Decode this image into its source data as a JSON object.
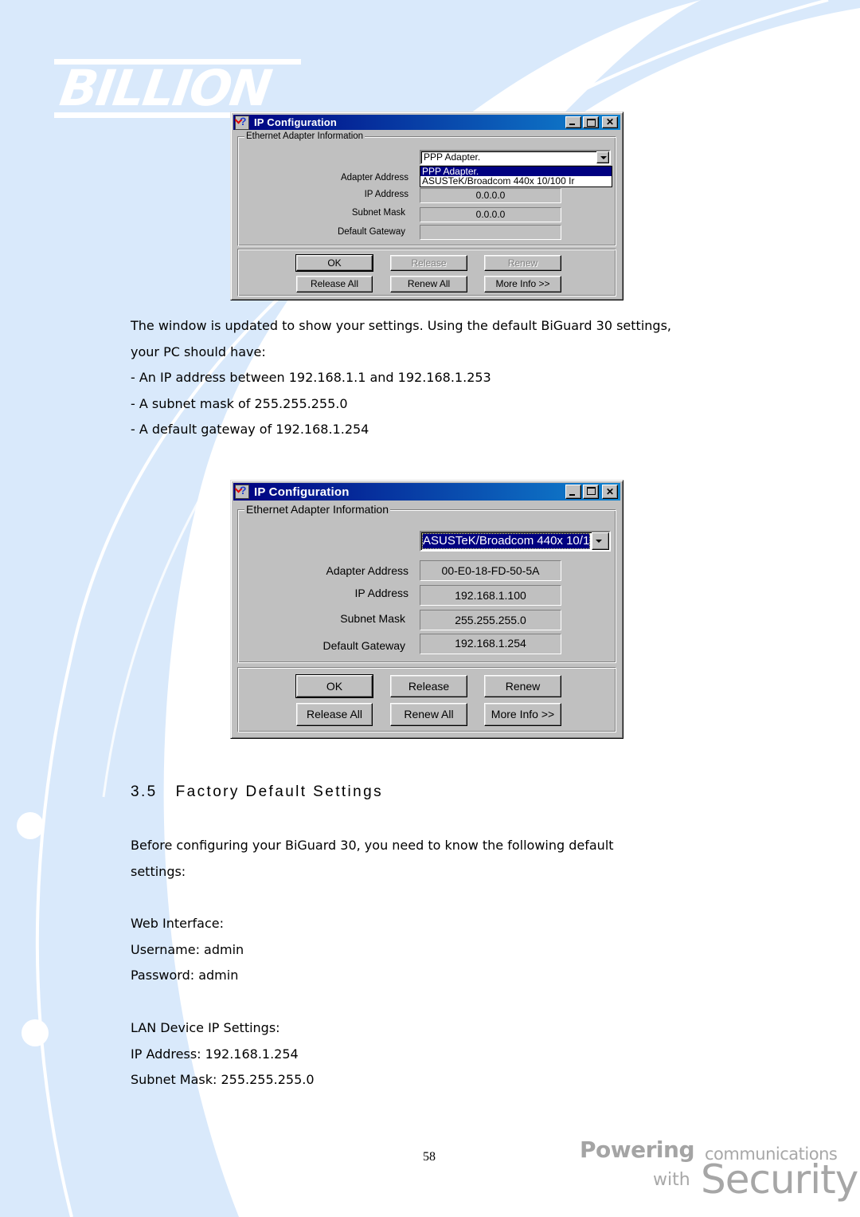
{
  "brand": {
    "logo_text": "BILLION",
    "tagline_powering": "Powering",
    "tagline_communications": "communications",
    "tagline_with": "with",
    "tagline_security": "Security",
    "colors": {
      "background_sweep": "#d9e9fb",
      "titlebar_start": "#000080",
      "titlebar_end": "#1084d0",
      "dialog_face": "#c0c0c0"
    }
  },
  "dialog1": {
    "title": "IP Configuration",
    "title_icon": "help-question-icon",
    "group_label": "Ethernet  Adapter Information",
    "adapter_select_value": "PPP Adapter.",
    "dropdown_open": true,
    "dropdown_options": [
      {
        "label": "PPP Adapter.",
        "highlighted": true
      },
      {
        "label": "ASUSTeK/Broadcom 440x 10/100 Ir",
        "highlighted": false
      }
    ],
    "rows": [
      {
        "label": "Adapter Address",
        "value": ""
      },
      {
        "label": "IP Address",
        "value": "0.0.0.0"
      },
      {
        "label": "Subnet Mask",
        "value": "0.0.0.0"
      },
      {
        "label": "Default Gateway",
        "value": ""
      }
    ],
    "buttons": [
      {
        "label": "OK",
        "enabled": true,
        "default": true
      },
      {
        "label": "Release",
        "enabled": false
      },
      {
        "label": "Renew",
        "enabled": false
      },
      {
        "label": "Release All",
        "enabled": true
      },
      {
        "label": "Renew All",
        "enabled": true
      },
      {
        "label": "More Info >>",
        "enabled": true
      }
    ]
  },
  "paragraph1": {
    "lines": [
      "The window is updated to show your settings. Using the default BiGuard 30 settings,",
      "your PC should have:",
      "- An IP address between 192.168.1.1 and 192.168.1.253",
      "- A subnet mask of 255.255.255.0",
      "- A default gateway of 192.168.1.254"
    ]
  },
  "dialog2": {
    "title": "IP Configuration",
    "title_icon": "help-question-icon",
    "group_label": "Ethernet  Adapter Information",
    "adapter_select_value": "ASUSTeK/Broadcom 440x 10/1",
    "rows": [
      {
        "label": "Adapter Address",
        "value": "00-E0-18-FD-50-5A"
      },
      {
        "label": "IP Address",
        "value": "192.168.1.100"
      },
      {
        "label": "Subnet Mask",
        "value": "255.255.255.0"
      },
      {
        "label": "Default Gateway",
        "value": "192.168.1.254"
      }
    ],
    "buttons": [
      {
        "label": "OK",
        "enabled": true,
        "default": true
      },
      {
        "label": "Release",
        "enabled": true
      },
      {
        "label": "Renew",
        "enabled": true
      },
      {
        "label": "Release All",
        "enabled": true
      },
      {
        "label": "Renew All",
        "enabled": true
      },
      {
        "label": "More Info >>",
        "enabled": true
      }
    ]
  },
  "section": {
    "heading": "3.5   Factory Default Settings",
    "intro_lines": [
      "Before configuring your BiGuard 30, you need to know the following default",
      "settings:"
    ],
    "web_interface": {
      "title": "Web Interface:",
      "username": "Username: admin",
      "password": "Password: admin"
    },
    "lan_settings": {
      "title": "LAN Device IP Settings:",
      "ip_address": "IP Address: 192.168.1.254",
      "subnet_mask": "Subnet Mask: 255.255.255.0"
    }
  },
  "footer": {
    "page_number": "58"
  }
}
